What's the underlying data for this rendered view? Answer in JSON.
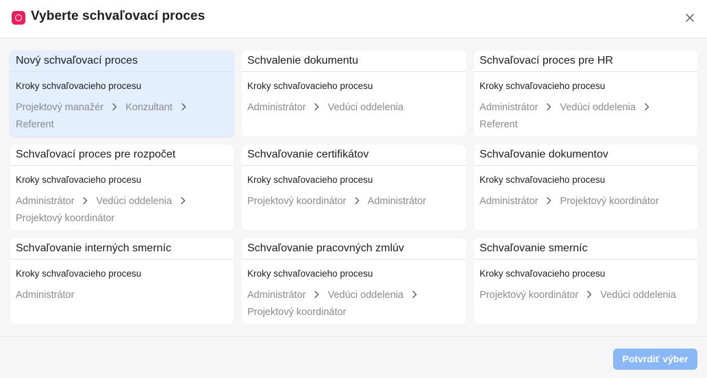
{
  "header": {
    "title": "Vyberte schvaľovací proces",
    "icon": "approval-process-icon",
    "accent_color": "#ec1d5f"
  },
  "cards": [
    {
      "title": "Nový schvaľovací proces",
      "steps_label": "Kroky schvaľovacieho procesu",
      "steps": [
        "Projektový manažér",
        "Konzultant",
        "Referent"
      ],
      "selected": true
    },
    {
      "title": "Schvalenie dokumentu",
      "steps_label": "Kroky schvaľovacieho procesu",
      "steps": [
        "Administrátor",
        "Vedúci oddelenia"
      ],
      "selected": false
    },
    {
      "title": "Schvaľovací proces pre HR",
      "steps_label": "Kroky schvaľovacieho procesu",
      "steps": [
        "Administrátor",
        "Vedúci oddelenia",
        "Referent"
      ],
      "selected": false
    },
    {
      "title": "Schvaľovací proces pre rozpočet",
      "steps_label": "Kroky schvaľovacieho procesu",
      "steps": [
        "Administrátor",
        "Vedúci oddelenia",
        "Projektový koordinátor"
      ],
      "selected": false
    },
    {
      "title": "Schvaľovanie certifikátov",
      "steps_label": "Kroky schvaľovacieho procesu",
      "steps": [
        "Projektový koordinátor",
        "Administrátor"
      ],
      "selected": false
    },
    {
      "title": "Schvaľovanie dokumentov",
      "steps_label": "Kroky schvaľovacieho procesu",
      "steps": [
        "Administrátor",
        "Projektový koordinátor"
      ],
      "selected": false
    },
    {
      "title": "Schvaľovanie interných smerníc",
      "steps_label": "Kroky schvaľovacieho procesu",
      "steps": [
        "Administrátor"
      ],
      "selected": false
    },
    {
      "title": "Schvaľovanie pracovných zmlúv",
      "steps_label": "Kroky schvaľovacieho procesu",
      "steps": [
        "Administrátor",
        "Vedúci oddelenia",
        "Projektový koordinátor"
      ],
      "selected": false
    },
    {
      "title": "Schvaľovanie smerníc",
      "steps_label": "Kroky schvaľovacieho procesu",
      "steps": [
        "Projektový koordinátor",
        "Vedúci oddelenia"
      ],
      "selected": false
    }
  ],
  "footer": {
    "confirm_label": "Potvrdiť výber",
    "confirm_color": "#8ab8f6"
  },
  "colors": {
    "selected_card_bg": "#e3effd",
    "step_text": "#8a8a8e"
  }
}
